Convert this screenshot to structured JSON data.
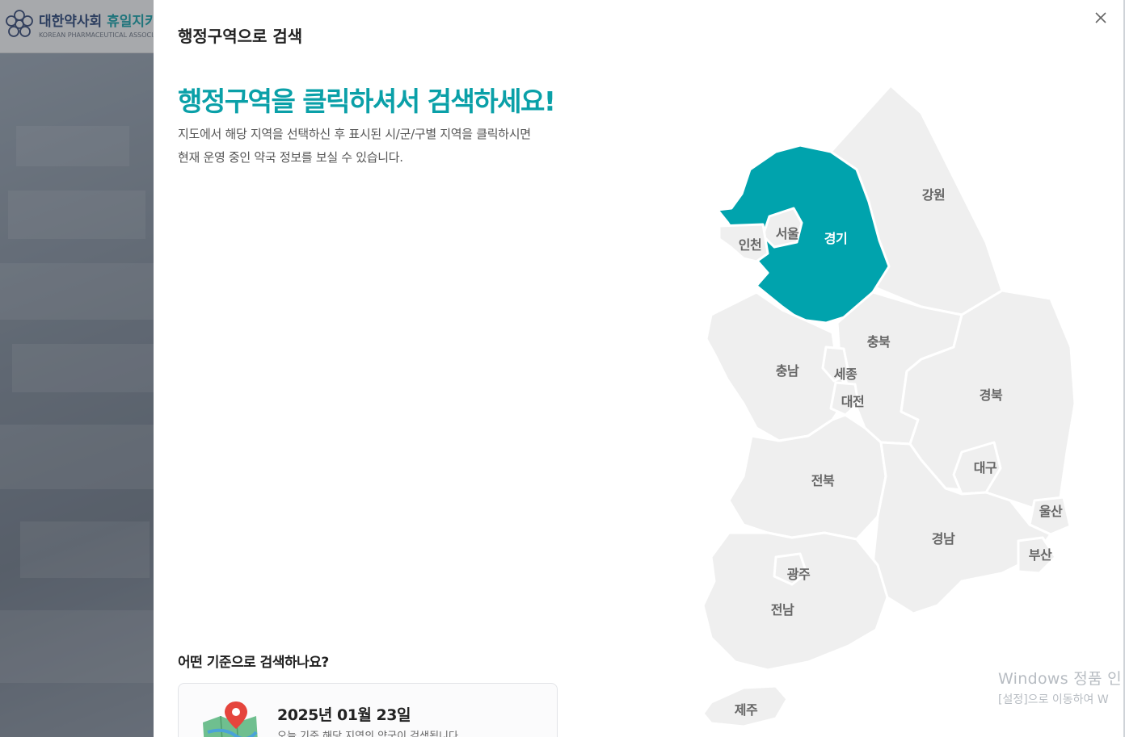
{
  "background": {
    "logo": {
      "name_main": "대한약사회",
      "name_accent": "휴일지키",
      "name_sub": "KOREAN PHARMACEUTICAL ASSOCIATI"
    }
  },
  "modal": {
    "title": "행정구역으로 검색",
    "close_icon": "close-icon",
    "headline": "행정구역을 클릭하셔서 검색하세요!",
    "description": [
      "지도에서 해당 지역을 선택하신 후 표시된 시/군/구별 지역을 클릭하시면",
      "현재 운영 중인 약국 정보를 보실 수 있습니다."
    ],
    "criteria": {
      "question": "어떤 기준으로 검색하나요?",
      "date": "2025년 01월 23일",
      "sub": "오늘 기준 해당 지역의 약국이 검색됩니다."
    }
  },
  "map": {
    "selected_region": "경기",
    "colors": {
      "selected": "#00a3ad",
      "region": "#efefef",
      "border": "#ffffff"
    },
    "regions": {
      "gangwon": "강원",
      "gyeonggi": "경기",
      "seoul": "서울",
      "incheon": "인천",
      "chungbuk": "충북",
      "chungnam": "충남",
      "sejong": "세종",
      "daejeon": "대전",
      "gyeongbuk": "경북",
      "daegu": "대구",
      "jeonbuk": "전북",
      "ulsan": "울산",
      "gyeongnam": "경남",
      "busan": "부산",
      "gwangju": "광주",
      "jeonnam": "전남",
      "jeju": "제주"
    }
  },
  "watermark": {
    "line1": "Windows 정품 인",
    "line2": "[설정]으로 이동하여 W"
  }
}
